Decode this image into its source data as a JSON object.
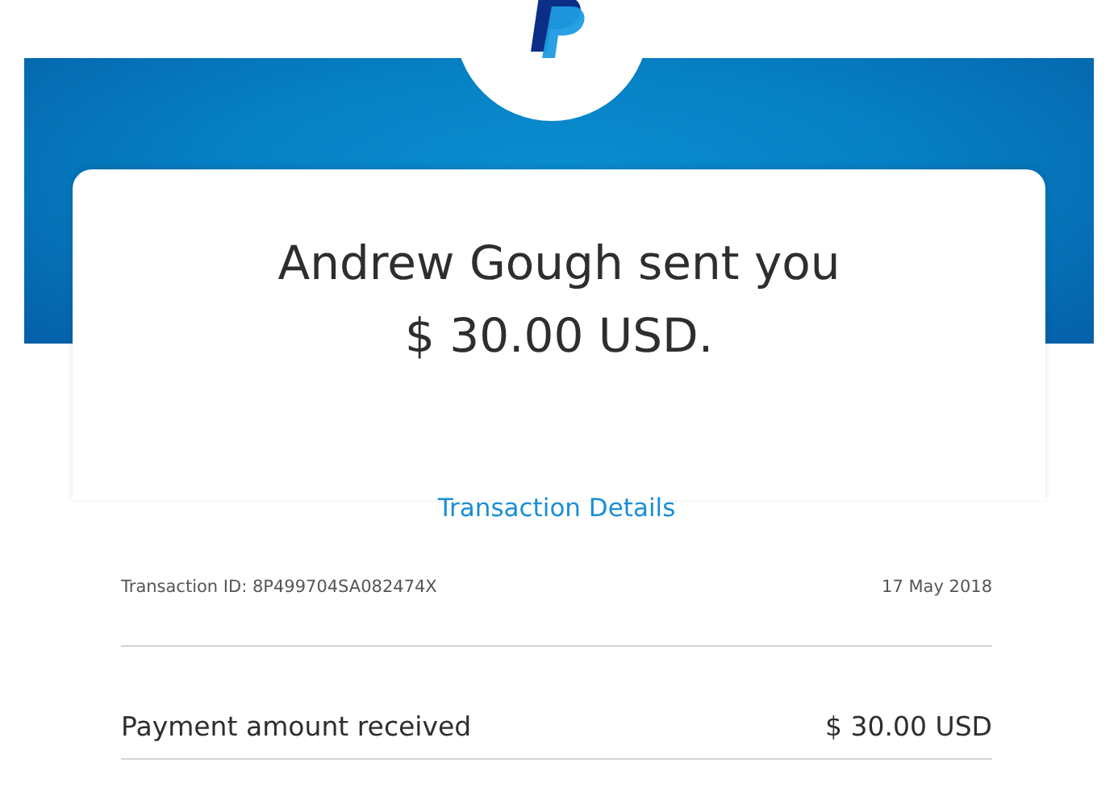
{
  "message": {
    "headline": "Andrew Gough sent you",
    "amount": "$ 30.00 USD."
  },
  "details_link": "Transaction Details",
  "transaction": {
    "id_label": "Transaction ID: 8P499704SA082474X",
    "date": "17 May 2018"
  },
  "rows": [
    {
      "label": "Payment amount received",
      "value": "$ 30.00 USD"
    }
  ]
}
